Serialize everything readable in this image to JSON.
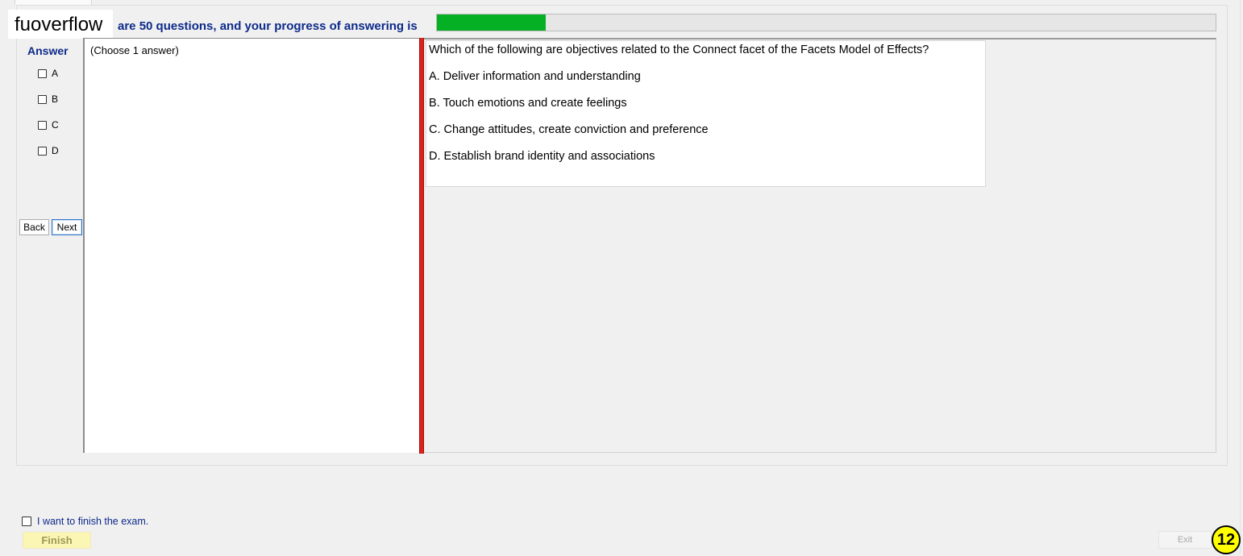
{
  "watermark": "fuoverflow",
  "header": {
    "progress_text": "are 50 questions, and your progress of answering is",
    "progress_fraction": 0.14,
    "progress_color": "#06b025"
  },
  "answer_panel": {
    "title": "Answer",
    "options": [
      {
        "label": "A",
        "checked": false
      },
      {
        "label": "B",
        "checked": false
      },
      {
        "label": "C",
        "checked": false
      },
      {
        "label": "D",
        "checked": false
      }
    ],
    "back_label": "Back",
    "next_label": "Next"
  },
  "note": {
    "text": "(Choose 1 answer)"
  },
  "question": {
    "stem": "Which of the following are objectives related to the Connect facet of the Facets Model of Effects?",
    "choices": [
      "A.  Deliver information and understanding",
      "B.  Touch emotions and create feelings",
      "C.  Change attitudes, create conviction and preference",
      "D.  Establish brand identity and associations"
    ]
  },
  "footer": {
    "finish_check_label": "I want to finish the exam.",
    "finish_label": "Finish",
    "exit_label": "Exit",
    "page_badge": "12"
  },
  "colors": {
    "accent_text": "#0d2a8a",
    "splitter": "#e0201a",
    "finish_bg": "#fcf6b4",
    "badge_bg": "#ffff00"
  }
}
